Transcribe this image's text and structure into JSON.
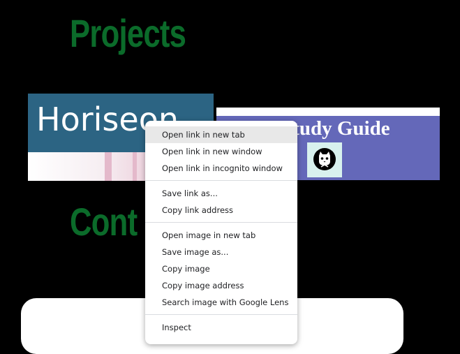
{
  "headings": {
    "projects": "Projects",
    "contact": "Cont"
  },
  "cards": {
    "horiseon": {
      "banner_text": "Horiseon"
    },
    "study_guide": {
      "title": "x Study Guide",
      "logo_icon": "cat-logo-icon"
    }
  },
  "context_menu": {
    "groups": [
      [
        "Open link in new tab",
        "Open link in new window",
        "Open link in incognito window"
      ],
      [
        "Save link as...",
        "Copy link address"
      ],
      [
        "Open image in new tab",
        "Save image as...",
        "Copy image",
        "Copy image address",
        "Search image with Google Lens"
      ],
      [
        "Inspect"
      ]
    ],
    "highlighted": "Open link in new tab"
  },
  "colors": {
    "background": "#000000",
    "heading": "#0b6b2a",
    "horiseon_banner": "#2c6483",
    "study_panel": "#6468b9",
    "menu_highlight": "#e8e8e8"
  }
}
